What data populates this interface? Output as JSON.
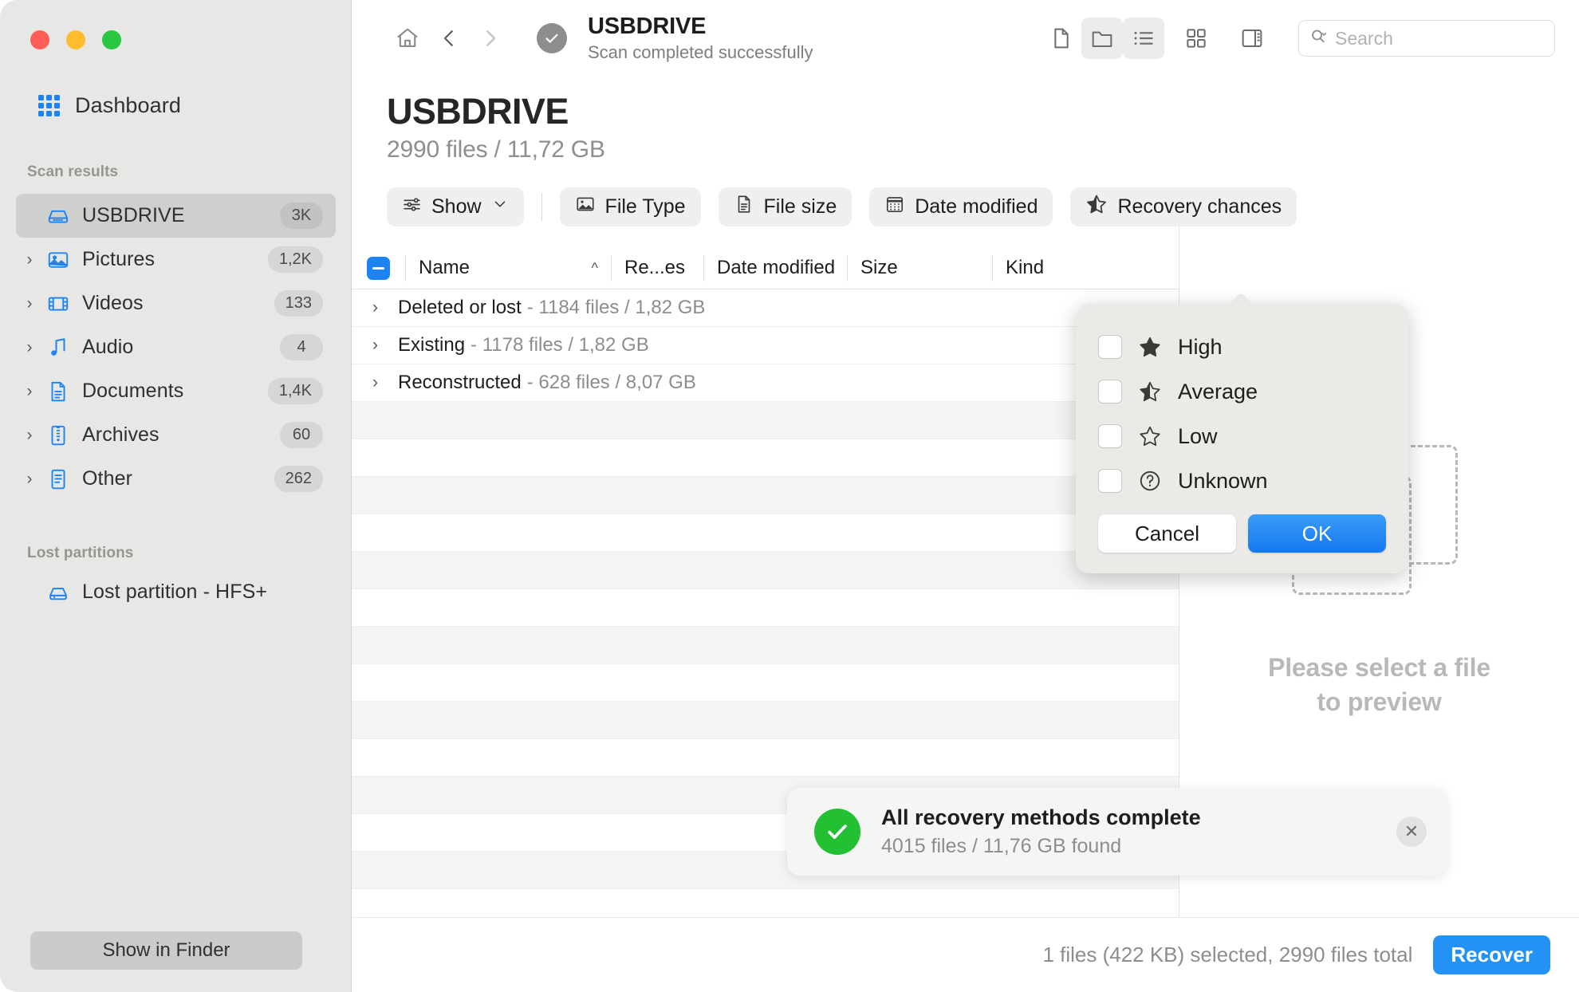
{
  "window": {
    "traffic_lights": [
      "close",
      "minimize",
      "zoom"
    ]
  },
  "sidebar": {
    "dashboard_label": "Dashboard",
    "scan_results_heading": "Scan results",
    "lost_partitions_heading": "Lost partitions",
    "scan_results": [
      {
        "label": "USBDRIVE",
        "badge": "3K",
        "icon": "drive-icon",
        "expandable": false,
        "selected": true
      },
      {
        "label": "Pictures",
        "badge": "1,2K",
        "icon": "picture-icon",
        "expandable": true,
        "selected": false
      },
      {
        "label": "Videos",
        "badge": "133",
        "icon": "video-icon",
        "expandable": true,
        "selected": false
      },
      {
        "label": "Audio",
        "badge": "4",
        "icon": "audio-icon",
        "expandable": true,
        "selected": false
      },
      {
        "label": "Documents",
        "badge": "1,4K",
        "icon": "document-icon",
        "expandable": true,
        "selected": false
      },
      {
        "label": "Archives",
        "badge": "60",
        "icon": "archive-icon",
        "expandable": true,
        "selected": false
      },
      {
        "label": "Other",
        "badge": "262",
        "icon": "other-file-icon",
        "expandable": true,
        "selected": false
      }
    ],
    "lost_partitions": [
      {
        "label": "Lost partition - HFS+",
        "icon": "drive-icon"
      }
    ],
    "show_in_finder_label": "Show in Finder"
  },
  "toolbar": {
    "home_icon": "home-icon",
    "back_icon": "chevron-left-icon",
    "forward_icon": "chevron-right-icon",
    "status_icon": "check-circle-icon",
    "title": "USBDRIVE",
    "subtitle": "Scan completed successfully",
    "view_buttons": [
      {
        "name": "file-view-icon",
        "active": false
      },
      {
        "name": "folder-view-icon",
        "active": true
      },
      {
        "name": "list-view-icon",
        "active": true
      },
      {
        "name": "grid-view-icon",
        "active": false
      },
      {
        "name": "sidebar-panel-icon",
        "active": false
      }
    ],
    "search": {
      "placeholder": "Search",
      "value": "",
      "icon": "search-icon"
    }
  },
  "page": {
    "title": "USBDRIVE",
    "subtitle": "2990 files / 11,72 GB"
  },
  "filters": {
    "show_label": "Show",
    "show_icon": "sliders-icon",
    "show_caret": "chevron-down-icon",
    "chips": [
      {
        "label": "File Type",
        "icon": "image-icon"
      },
      {
        "label": "File size",
        "icon": "document-icon"
      },
      {
        "label": "Date modified",
        "icon": "calendar-icon"
      },
      {
        "label": "Recovery chances",
        "icon": "star-half-icon"
      }
    ]
  },
  "table": {
    "select_all_state": "indeterminate",
    "columns": [
      {
        "key": "name",
        "label": "Name",
        "sort": "asc",
        "sort_caret": "chevron-up-icon"
      },
      {
        "key": "rec",
        "label": "Re...es"
      },
      {
        "key": "date",
        "label": "Date modified"
      },
      {
        "key": "size",
        "label": "Size"
      },
      {
        "key": "kind",
        "label": "Kind"
      }
    ],
    "groups": [
      {
        "title": "Deleted or lost",
        "meta": "- 1184 files / 1,82 GB",
        "expanded": false
      },
      {
        "title": "Existing",
        "meta": "- 1178 files / 1,82 GB",
        "expanded": false
      },
      {
        "title": "Reconstructed",
        "meta": "- 628 files / 8,07 GB",
        "expanded": false
      }
    ]
  },
  "preview": {
    "message_line1": "Please select a file",
    "message_line2": "to preview",
    "placeholder_icon": "empty-file-stack-icon"
  },
  "popover": {
    "title_source": "Recovery chances",
    "options": [
      {
        "label": "High",
        "icon": "star-filled-icon",
        "checked": false
      },
      {
        "label": "Average",
        "icon": "star-half-icon",
        "checked": false
      },
      {
        "label": "Low",
        "icon": "star-outline-icon",
        "checked": false
      },
      {
        "label": "Unknown",
        "icon": "question-circle-icon",
        "checked": false
      }
    ],
    "cancel_label": "Cancel",
    "ok_label": "OK"
  },
  "toast": {
    "icon": "check-circle-filled-icon",
    "title": "All recovery methods complete",
    "subtitle": "4015 files / 11,76 GB found",
    "close_icon": "close-icon"
  },
  "statusbar": {
    "status_text": "1 files (422 KB) selected, 2990 files total",
    "recover_label": "Recover"
  },
  "colors": {
    "accent_blue": "#1b83f2",
    "recover_blue": "#2491f5",
    "success_green": "#22c032",
    "sidebar_bg": "#e7e7e6",
    "popover_bg": "#ebeae7"
  }
}
